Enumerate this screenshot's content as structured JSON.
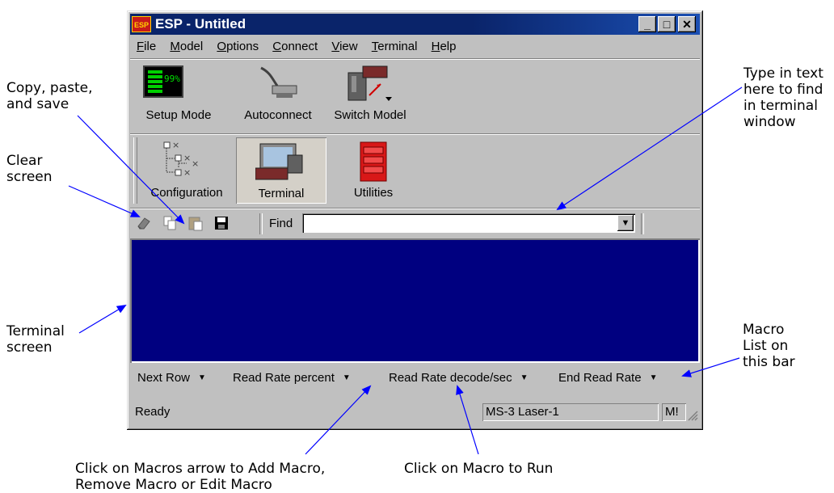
{
  "window": {
    "logo_text": "ESP",
    "title": "ESP - Untitled",
    "controls": {
      "minimize": "_",
      "maximize": "□",
      "close": "✕"
    }
  },
  "menu": [
    {
      "underline": "F",
      "rest": "ile"
    },
    {
      "underline": "M",
      "rest": "odel"
    },
    {
      "underline": "O",
      "rest": "ptions"
    },
    {
      "underline": "C",
      "rest": "onnect"
    },
    {
      "underline": "V",
      "rest": "iew"
    },
    {
      "underline": "T",
      "rest": "erminal"
    },
    {
      "underline": "H",
      "rest": "elp"
    }
  ],
  "toolbar_top": {
    "setup_mode": {
      "label": "Setup Mode",
      "readout": "99%"
    },
    "autoconnect": {
      "label": "Autoconnect"
    },
    "switch_model": {
      "label": "Switch Model"
    }
  },
  "toolbar_views": {
    "configuration": {
      "label": "Configuration"
    },
    "terminal": {
      "label": "Terminal",
      "selected": true
    },
    "utilities": {
      "label": "Utilities"
    }
  },
  "findbar": {
    "find_label": "Find",
    "find_value": "",
    "icons": [
      "eraser-icon",
      "copy-icon",
      "paste-icon",
      "save-icon"
    ]
  },
  "terminal": {
    "background": "#000080"
  },
  "macros": [
    {
      "label": "Next Row"
    },
    {
      "label": "Read Rate percent"
    },
    {
      "label": "Read Rate decode/sec"
    },
    {
      "label": "End Read Rate"
    }
  ],
  "status": {
    "state": "Ready",
    "model": "MS-3 Laser-1",
    "extra": "M!"
  },
  "callouts": {
    "copy_paste_save": "Copy, paste,\nand save",
    "clear_screen": "Clear\nscreen",
    "terminal_screen": "Terminal\nscreen",
    "find_text": "Type in text\nhere to find\nin terminal\nwindow",
    "macro_list": "Macro\nList on\nthis bar",
    "macros_arrow": "Click on Macros arrow to Add Macro,\nRemove Macro or Edit Macro",
    "macro_run": "Click on Macro to Run"
  },
  "colors": {
    "titlebar": "#0a246a",
    "terminal_bg": "#000080",
    "window_face": "#c0c0c0",
    "arrow": "#0000ff"
  }
}
